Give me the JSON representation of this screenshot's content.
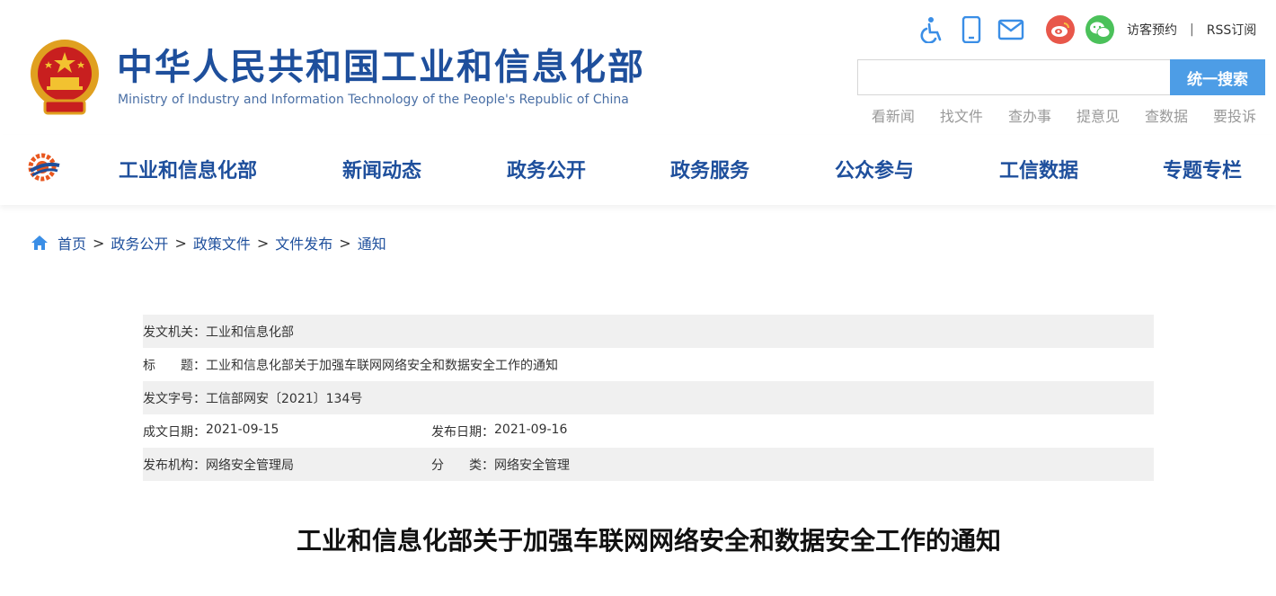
{
  "header": {
    "title": "中华人民共和国工业和信息化部",
    "subtitle": "Ministry of Industry and Information Technology of the People's Republic of China",
    "visitor_link": "访客预约",
    "separator": "|",
    "rss_link": "RSS订阅",
    "search": {
      "placeholder": "",
      "button_label": "统一搜索"
    },
    "quick_links": [
      "看新闻",
      "找文件",
      "查办事",
      "提意见",
      "查数据",
      "要投诉"
    ]
  },
  "nav": {
    "items": [
      "工业和信息化部",
      "新闻动态",
      "政务公开",
      "政务服务",
      "公众参与",
      "工信数据",
      "专题专栏"
    ]
  },
  "breadcrumb": {
    "items": [
      "首页",
      "政务公开",
      "政策文件",
      "文件发布",
      "通知"
    ],
    "separator": ">"
  },
  "meta": {
    "issuer_label": "发文机关：",
    "issuer": "工业和信息化部",
    "title_label": "标　　题：",
    "title": "工业和信息化部关于加强车联网网络安全和数据安全工作的通知",
    "doc_no_label": "发文字号：",
    "doc_no": "工信部网安〔2021〕134号",
    "written_label": "成文日期：",
    "written": "2021-09-15",
    "published_label": "发布日期：",
    "published": "2021-09-16",
    "org_label": "发布机构：",
    "org": "网络安全管理局",
    "category_label": "分　　类：",
    "category": "网络安全管理"
  },
  "document": {
    "title": "工业和信息化部关于加强车联网网络安全和数据安全工作的通知"
  },
  "colors": {
    "brand_blue": "#1e4f9c",
    "search_button": "#4d9de6",
    "weibo": "#e8574a",
    "wechat": "#4bc15a"
  },
  "icons": [
    "accessibility-icon",
    "mobile-icon",
    "mail-icon",
    "weibo-icon",
    "wechat-icon",
    "home-icon"
  ]
}
